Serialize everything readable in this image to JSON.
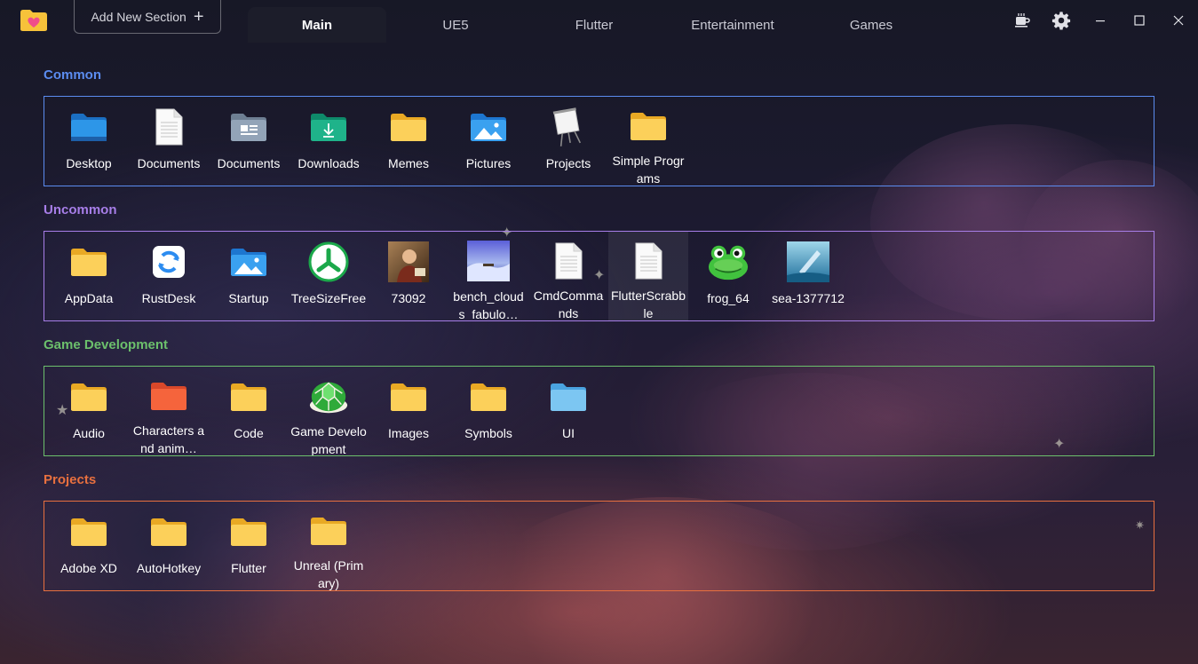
{
  "toolbar": {
    "add_section_label": "Add New Section",
    "add_icon": "plus-icon"
  },
  "tabs": [
    {
      "label": "Main",
      "active": true
    },
    {
      "label": "UE5",
      "active": false
    },
    {
      "label": "Flutter",
      "active": false
    },
    {
      "label": "Entertainment",
      "active": false
    },
    {
      "label": "Games",
      "active": false
    }
  ],
  "window_controls": [
    "coffee-icon",
    "gear-icon",
    "minimize-icon",
    "maximize-icon",
    "close-icon"
  ],
  "sections": [
    {
      "title": "Common",
      "color": "#5b8cf0",
      "items": [
        {
          "label": "Desktop",
          "icon": "desktop-folder-icon"
        },
        {
          "label": "Documents",
          "icon": "document-icon"
        },
        {
          "label": "Documents",
          "icon": "documents-folder-icon"
        },
        {
          "label": "Downloads",
          "icon": "downloads-folder-icon"
        },
        {
          "label": "Memes",
          "icon": "folder-icon"
        },
        {
          "label": "Pictures",
          "icon": "pictures-folder-icon"
        },
        {
          "label": "Projects",
          "icon": "easel-icon"
        },
        {
          "label": "Simple Programs",
          "icon": "folder-icon"
        }
      ]
    },
    {
      "title": "Uncommon",
      "color": "#a77ee8",
      "items": [
        {
          "label": "AppData",
          "icon": "folder-icon"
        },
        {
          "label": "RustDesk",
          "icon": "rustdesk-icon"
        },
        {
          "label": "Startup",
          "icon": "pictures-folder-icon"
        },
        {
          "label": "TreeSizeFree",
          "icon": "treesize-icon"
        },
        {
          "label": "73092",
          "icon": "portrait-image-icon"
        },
        {
          "label": "bench_clouds_fabulo…",
          "icon": "landscape-image-icon"
        },
        {
          "label": "CmdCommands",
          "icon": "document-icon"
        },
        {
          "label": "FlutterScrabble",
          "icon": "document-icon"
        },
        {
          "label": "frog_64",
          "icon": "frog-icon"
        },
        {
          "label": "sea-1377712",
          "icon": "sea-image-icon"
        }
      ]
    },
    {
      "title": "Game Development",
      "color": "#6cc06c",
      "items": [
        {
          "label": "Audio",
          "icon": "folder-icon"
        },
        {
          "label": "Characters and anim…",
          "icon": "orange-folder-icon"
        },
        {
          "label": "Code",
          "icon": "folder-icon"
        },
        {
          "label": "Game Development",
          "icon": "turtle-shell-icon"
        },
        {
          "label": "Images",
          "icon": "folder-icon"
        },
        {
          "label": "Symbols",
          "icon": "folder-icon"
        },
        {
          "label": "UI",
          "icon": "blue-folder-icon"
        }
      ]
    },
    {
      "title": "Projects",
      "color": "#e8703f",
      "items": [
        {
          "label": "Adobe XD",
          "icon": "folder-icon"
        },
        {
          "label": "AutoHotkey",
          "icon": "folder-icon"
        },
        {
          "label": "Flutter",
          "icon": "folder-icon"
        },
        {
          "label": "Unreal (Primary)",
          "icon": "folder-icon"
        }
      ]
    }
  ]
}
